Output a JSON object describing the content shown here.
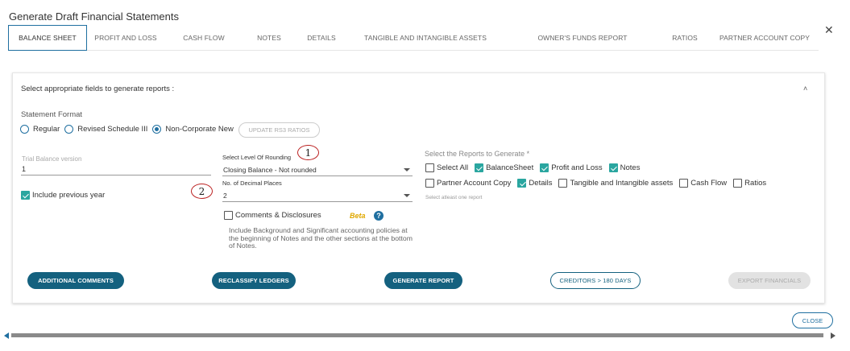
{
  "dialog": {
    "title": "Generate Draft Financial Statements",
    "close_icon": "close-icon"
  },
  "tabs": [
    {
      "label": "BALANCE SHEET",
      "active": true
    },
    {
      "label": "PROFIT AND LOSS",
      "active": false
    },
    {
      "label": "CASH FLOW",
      "active": false
    },
    {
      "label": "NOTES",
      "active": false
    },
    {
      "label": "DETAILS",
      "active": false
    },
    {
      "label": "TANGIBLE AND INTANGIBLE ASSETS",
      "active": false
    },
    {
      "label": "OWNER'S FUNDS REPORT",
      "active": false
    },
    {
      "label": "RATIOS",
      "active": false
    },
    {
      "label": "PARTNER ACCOUNT COPY",
      "active": false
    }
  ],
  "panel": {
    "heading": "Select appropriate fields to generate reports :",
    "collapse_icon": "chevron-up-icon"
  },
  "statement_format": {
    "label": "Statement Format",
    "options": [
      {
        "label": "Regular",
        "selected": false
      },
      {
        "label": "Revised Schedule III",
        "selected": false
      },
      {
        "label": "Non-Corporate New",
        "selected": true
      }
    ],
    "update_button": "UPDATE RS3 RATIOS"
  },
  "trial_balance": {
    "label": "Trial Balance version",
    "value": "1"
  },
  "include_previous_year": {
    "label": "Include previous year",
    "checked": true
  },
  "annotations": {
    "one": "1",
    "two": "2"
  },
  "rounding": {
    "label": "Select Level Of Rounding",
    "value": "Closing Balance - Not rounded"
  },
  "decimal_places": {
    "label": "No. of Decimal Places",
    "value": "2"
  },
  "comments": {
    "label": "Comments & Disclosures",
    "checked": false,
    "beta": "Beta",
    "help_icon": "?",
    "info": "Include Background and Significant accounting policies at the beginning of Notes and the other sections at the bottom of Notes."
  },
  "reports": {
    "label": "Select the Reports to Generate *",
    "row1": [
      {
        "label": "Select All",
        "checked": false
      },
      {
        "label": "BalanceSheet",
        "checked": true
      },
      {
        "label": "Profit and Loss",
        "checked": true
      },
      {
        "label": "Notes",
        "checked": true
      }
    ],
    "row2": [
      {
        "label": "Partner Account Copy",
        "checked": false
      },
      {
        "label": "Details",
        "checked": true
      },
      {
        "label": "Tangible and Intangible assets",
        "checked": false
      },
      {
        "label": "Cash Flow",
        "checked": false
      },
      {
        "label": "Ratios",
        "checked": false
      }
    ],
    "hint": "Select atleast one report"
  },
  "actions": {
    "additional_comments": "ADDITIONAL COMMENTS",
    "reclassify_ledgers": "RECLASSIFY LEDGERS",
    "generate_report": "GENERATE REPORT",
    "creditors": "CREDITORS > 180 DAYS",
    "export_financials": "EXPORT FINANCIALS"
  },
  "footer": {
    "close": "CLOSE"
  },
  "colors": {
    "primary": "#14617f",
    "checkbox": "#2aa6a0",
    "beta": "#e0a800"
  }
}
